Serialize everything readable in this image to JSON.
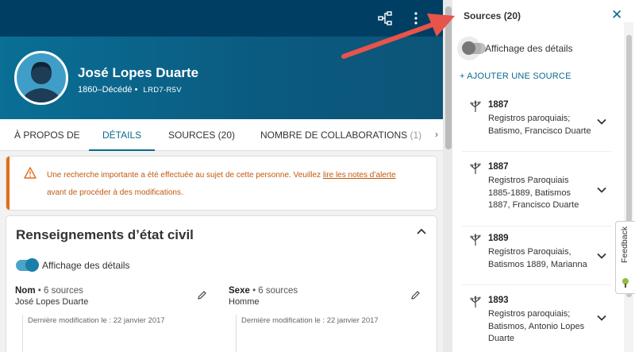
{
  "header": {
    "tree_icon": "tree-view-icon",
    "more_icon": "more-vertical-icon"
  },
  "person": {
    "name": "José Lopes Duarte",
    "lifespan": "1860–Décédé",
    "separator": "•",
    "id": "LRD7-R5V"
  },
  "tabs": [
    {
      "label": "À PROPOS DE"
    },
    {
      "label": "DÉTAILS"
    },
    {
      "label": "SOURCES (20)"
    },
    {
      "label": "NOMBRE DE COLLABORATIONS",
      "count": "(1)"
    }
  ],
  "alert": {
    "text_before": "Une recherche importante a été effectuée au sujet de cette personne. Veuillez ",
    "link": "lire les notes d’alerte",
    "text_after": "avant de procéder à des modifications."
  },
  "vital_card": {
    "title": "Renseignements d’état civil",
    "toggle_label": "Affichage des détails",
    "fields": [
      {
        "label": "Nom",
        "count": "6 sources",
        "value": "José Lopes Duarte",
        "modified": "Dernière modification le : 22 janvier 2017"
      },
      {
        "label": "Sexe",
        "count": "6 sources",
        "value": "Homme",
        "modified": "Dernière modification le : 22 janvier 2017"
      }
    ],
    "bullet": "•"
  },
  "sources_panel": {
    "title": "Sources (20)",
    "close": "✕",
    "toggle_label": "Affichage des détails",
    "add_label": "+ AJOUTER UNE SOURCE",
    "items": [
      {
        "year": "1887",
        "title": "Registros paroquiais; Batismo, Francisco Duarte"
      },
      {
        "year": "1887",
        "title": "Registros Paroquiais 1885-1889, Batismos 1887, Francisco Duarte"
      },
      {
        "year": "1889",
        "title": "Registros Paroquiais, Batismos 1889, Marianna"
      },
      {
        "year": "1893",
        "title": "Registros paroquiais; Batismos, Antonio Lopes Duarte"
      }
    ]
  },
  "feedback": {
    "label": "Feedback"
  },
  "colors": {
    "header_dark": "#003f63",
    "hero": "#0b6186",
    "accent": "#0a6a8f",
    "alert": "#e06c1a",
    "arrow": "#e8534a"
  }
}
